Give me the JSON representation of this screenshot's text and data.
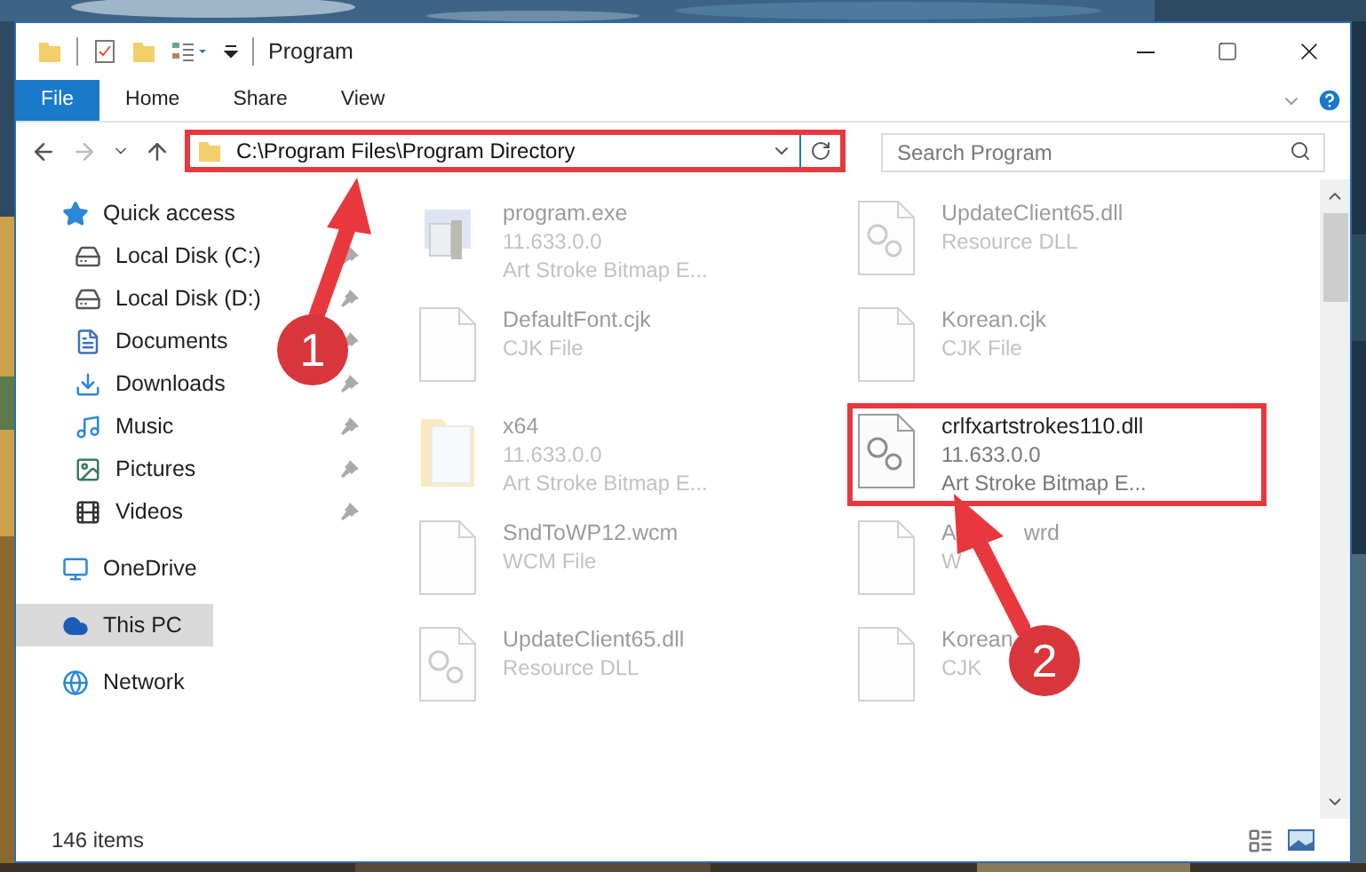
{
  "window": {
    "title": "Program"
  },
  "ribbon_tabs": [
    {
      "label": "File",
      "kind": "file"
    },
    {
      "label": "Home",
      "kind": "tab"
    },
    {
      "label": "Share",
      "kind": "tab"
    },
    {
      "label": "View",
      "kind": "tab"
    }
  ],
  "address_bar": {
    "path": "C:\\Program Files\\Program Directory",
    "highlighted": true
  },
  "search": {
    "placeholder": "Search Program"
  },
  "navigation": [
    {
      "label": "Quick access",
      "selected": false,
      "children": [
        {
          "label": "Local Disk (C:)",
          "pinned": true,
          "selected": false
        },
        {
          "label": "Local Disk (D:)",
          "pinned": true,
          "selected": false
        },
        {
          "label": "Documents",
          "pinned": true,
          "selected": false
        },
        {
          "label": "Downloads",
          "pinned": true,
          "selected": false
        },
        {
          "label": "Music",
          "pinned": true,
          "selected": false
        },
        {
          "label": "Pictures",
          "pinned": true,
          "selected": false
        },
        {
          "label": "Videos",
          "pinned": true,
          "selected": false
        }
      ]
    },
    {
      "label": "OneDrive",
      "selected": false
    },
    {
      "label": "This PC",
      "selected": true
    },
    {
      "label": "Network",
      "selected": false
    }
  ],
  "files": [
    {
      "name": "program.exe",
      "details": [
        "11.633.0.0",
        "Art Stroke Bitmap E..."
      ],
      "kind": "exe",
      "dimmed": true,
      "highlighted": false
    },
    {
      "name": "UpdateClient65.dll",
      "details": [
        "Resource DLL"
      ],
      "kind": "dll",
      "dimmed": true,
      "highlighted": false
    },
    {
      "name": "DefaultFont.cjk",
      "details": [
        "CJK File"
      ],
      "kind": "file",
      "dimmed": true,
      "highlighted": false
    },
    {
      "name": "Korean.cjk",
      "details": [
        "CJK File"
      ],
      "kind": "file",
      "dimmed": true,
      "highlighted": false
    },
    {
      "name": "x64",
      "details": [
        "11.633.0.0",
        "Art Stroke Bitmap E..."
      ],
      "kind": "folder",
      "dimmed": true,
      "highlighted": false
    },
    {
      "name": "crlfxartstrokes110.dll",
      "details": [
        "11.633.0.0",
        "Art Stroke Bitmap E..."
      ],
      "kind": "dll",
      "dimmed": false,
      "highlighted": true
    },
    {
      "name": "SndToWP12.wcm",
      "details": [
        "WCM File"
      ],
      "kind": "file",
      "dimmed": true,
      "highlighted": false
    },
    {
      "name": "A",
      "name_tail": "wrd",
      "details": [
        "W"
      ],
      "kind": "file",
      "dimmed": true,
      "highlighted": false
    },
    {
      "name": "UpdateClient65.dll",
      "details": [
        "Resource DLL"
      ],
      "kind": "dll",
      "dimmed": true,
      "highlighted": false
    },
    {
      "name": "Korean",
      "details": [
        "CJK"
      ],
      "kind": "file",
      "dimmed": true,
      "highlighted": false
    }
  ],
  "status_bar": {
    "item_count": "146 items"
  },
  "annotations": [
    {
      "number": "1"
    },
    {
      "number": "2"
    }
  ]
}
